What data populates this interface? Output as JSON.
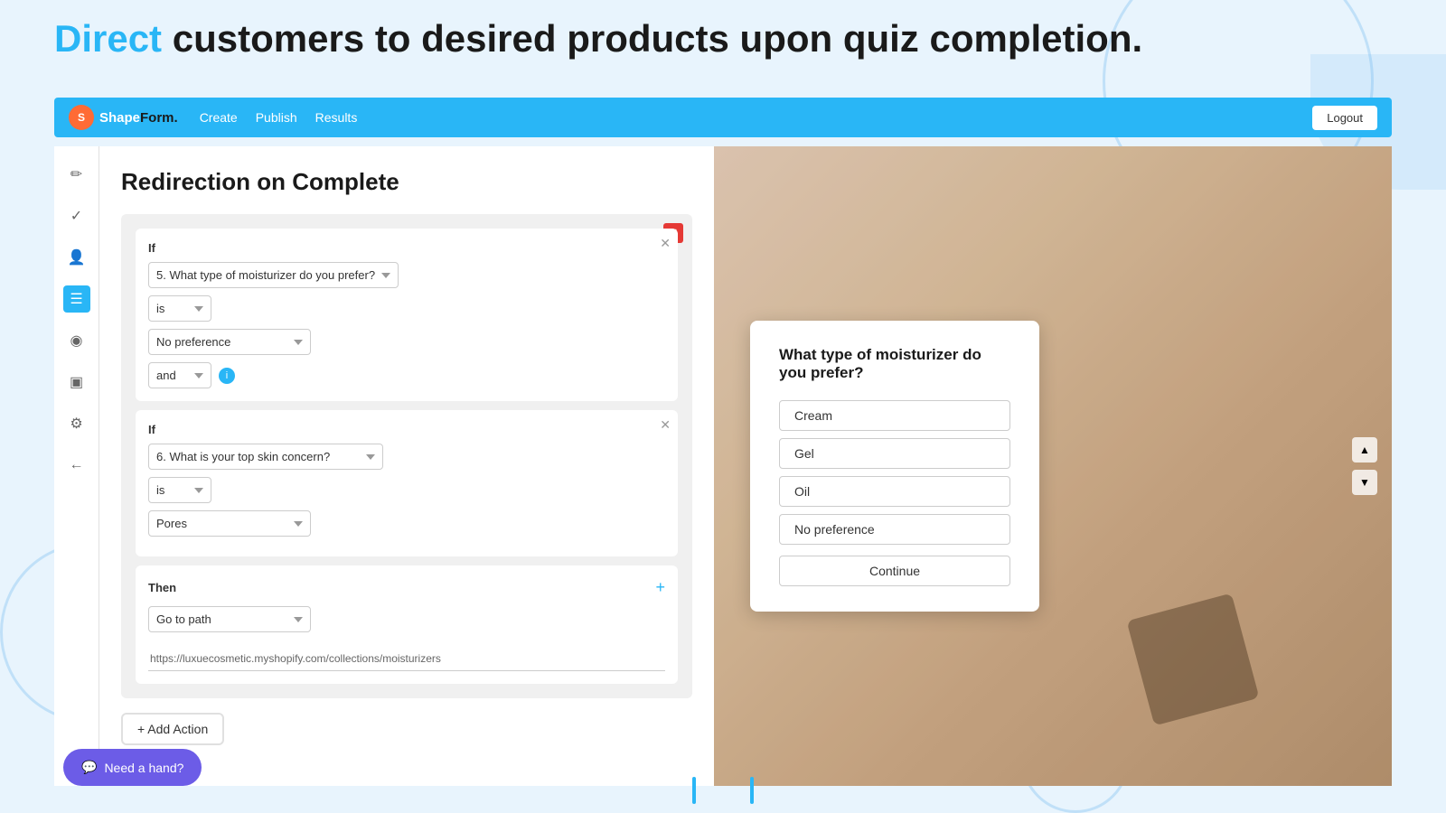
{
  "page": {
    "header": {
      "highlight": "Direct",
      "rest": " customers to desired products upon quiz completion."
    }
  },
  "navbar": {
    "brand": "ShapeForm.",
    "brand_highlight": "Form",
    "nav_items": [
      "Create",
      "Publish",
      "Results"
    ],
    "logout_label": "Logout"
  },
  "sidebar": {
    "icons": [
      {
        "name": "edit-icon",
        "symbol": "✏️",
        "active": false
      },
      {
        "name": "cursor-icon",
        "symbol": "✓",
        "active": false
      },
      {
        "name": "users-icon",
        "symbol": "👥",
        "active": false
      },
      {
        "name": "layout-icon",
        "symbol": "☰",
        "active": true
      },
      {
        "name": "eye-icon",
        "symbol": "👁",
        "active": false
      },
      {
        "name": "save-icon",
        "symbol": "💾",
        "active": false
      },
      {
        "name": "settings-icon",
        "symbol": "⚙",
        "active": false
      },
      {
        "name": "back-icon",
        "symbol": "←",
        "active": false
      }
    ]
  },
  "panel": {
    "title": "Redirection on Complete",
    "rule_card": {
      "condition1": {
        "label": "If",
        "question_select": "5. What type of moisturizer do you prefer?",
        "operator_select": "is",
        "answer_select": "No preference",
        "connector": "and"
      },
      "condition2": {
        "label": "If",
        "question_select": "6. What is your top skin concern?",
        "operator_select": "is",
        "answer_select": "Pores"
      },
      "then": {
        "label": "Then",
        "action_select": "Go to path",
        "url_value": "https://luxuecosmetic.myshopify.com/collections/moisturizers",
        "url_placeholder": "https://luxuecosmetic.myshopify.com/collections/moisturizers"
      }
    },
    "add_action_label": "+ Add Action"
  },
  "preview": {
    "question": "What type of moisturizer do you prefer?",
    "options": [
      "Cream",
      "Gel",
      "Oil",
      "No preference"
    ],
    "continue_label": "Continue"
  },
  "help": {
    "label": "Need a hand?"
  }
}
